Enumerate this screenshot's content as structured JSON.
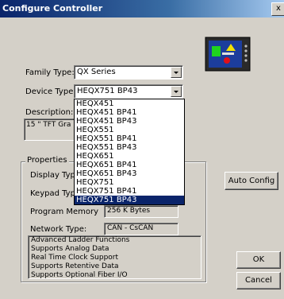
{
  "window": {
    "title": "Configure Controller",
    "close_glyph": "x"
  },
  "family": {
    "label": "Family Type:",
    "value": "QX Series"
  },
  "device": {
    "label": "Device Type:",
    "value": "HEQX751 BP43"
  },
  "description": {
    "label": "Description:",
    "text": "15 \" TFT Gra"
  },
  "dropdown": {
    "options": [
      "HEQX451",
      "HEQX451 BP41",
      "HEQX451 BP43",
      "HEQX551",
      "HEQX551 BP41",
      "HEQX551 BP43",
      "HEQX651",
      "HEQX651 BP41",
      "HEQX651 BP43",
      "HEQX751",
      "HEQX751 BP41",
      "HEQX751 BP43"
    ],
    "selected_index": 11
  },
  "properties": {
    "title": "Properties",
    "display_label": "Display Type",
    "keypad_label": "Keypad Type",
    "memory_label": "Program Memory",
    "memory_value": "256 K Bytes",
    "network_label": "Network Type:",
    "network_value": "CAN - CsCAN",
    "features": [
      "Advanced Ladder Functions",
      "Supports Analog Data",
      "Real Time Clock Support",
      "Supports Retentive Data",
      "Supports Optional Fiber I/O"
    ]
  },
  "buttons": {
    "auto_config": "Auto Config",
    "ok": "OK",
    "cancel": "Cancel"
  },
  "colors": {
    "titlebar": "#0a246a",
    "selection": "#0a246a",
    "face": "#d4d0c8"
  }
}
